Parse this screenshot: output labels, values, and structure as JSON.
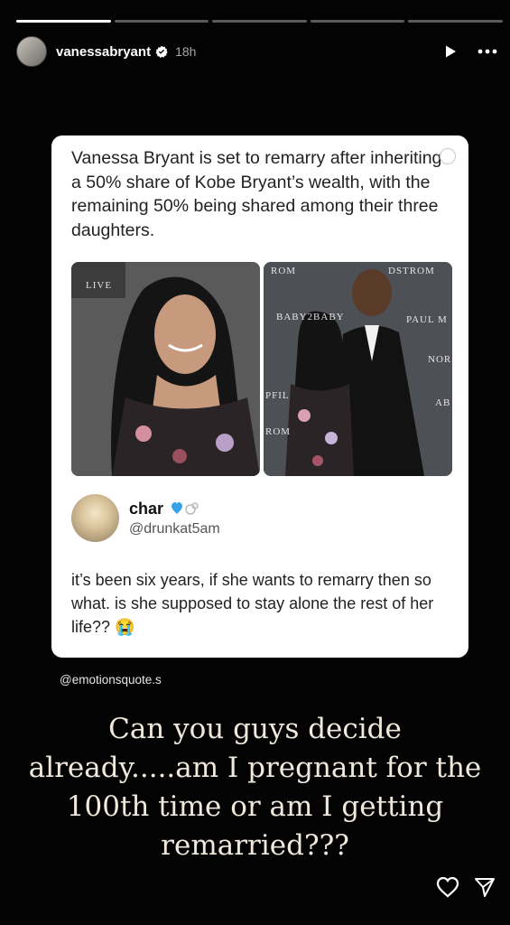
{
  "story": {
    "progress_segments": 5,
    "active_segment": 1,
    "username": "vanessabryant",
    "time_ago": "18h"
  },
  "post": {
    "text": "Vanessa Bryant is set to remarry after inheriting a 50% share of Kobe Bryant’s wealth, with the remaining 50% being shared among their three daughters.",
    "photo1_watermark": "LIVE",
    "photo2_watermarks": [
      "ROM",
      "DSTROM",
      "BABY2BABY",
      "PAUL M",
      "PFIL",
      "ROM",
      "AB",
      "NOR"
    ]
  },
  "reply": {
    "name": "char",
    "handle": "@drunkat5am",
    "text": "it’s been six years, if she wants to remarry then so what. is she supposed to stay alone the rest of her life?? 😭"
  },
  "credit": "@emotionsquote.s",
  "overlay_text": "Can you guys decide already.....am I pregnant for the 100th time or am I getting remarried???",
  "icons": {
    "verified": "verified-badge-icon",
    "play": "play-icon",
    "more": "more-icon",
    "like": "heart-icon",
    "share": "send-icon"
  },
  "colors": {
    "background": "#030303",
    "card": "#ffffff",
    "overlay_text": "#efe8dc",
    "verified": "#3897f0"
  }
}
